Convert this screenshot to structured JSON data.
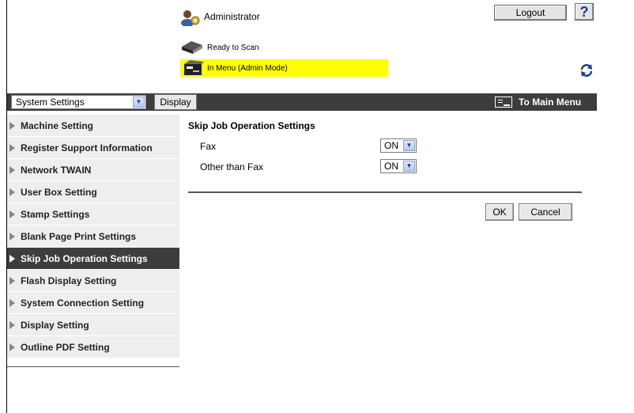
{
  "header": {
    "user_label": "Administrator",
    "logout_label": "Logout",
    "help_label": "?",
    "status_scan": "Ready to Scan",
    "status_menu": "In Menu (Admin Mode)"
  },
  "toolbar": {
    "category_select": "System Settings",
    "display_label": "Display",
    "main_menu_label": "To Main Menu"
  },
  "sidebar": {
    "items": [
      {
        "label": "Machine Setting"
      },
      {
        "label": "Register Support Information"
      },
      {
        "label": "Network TWAIN"
      },
      {
        "label": "User Box Setting"
      },
      {
        "label": "Stamp Settings"
      },
      {
        "label": "Blank Page Print Settings"
      },
      {
        "label": "Skip Job Operation Settings",
        "active": true
      },
      {
        "label": "Flash Display Setting"
      },
      {
        "label": "System Connection Setting"
      },
      {
        "label": "Display Setting"
      },
      {
        "label": "Outline PDF Setting"
      }
    ]
  },
  "main": {
    "title": "Skip Job Operation Settings",
    "rows": [
      {
        "label": "Fax",
        "value": "ON"
      },
      {
        "label": "Other than Fax",
        "value": "ON"
      }
    ],
    "ok_label": "OK",
    "cancel_label": "Cancel"
  },
  "colors": {
    "dark_bar": "#3d3d3d",
    "status_highlight": "#ffff00"
  }
}
